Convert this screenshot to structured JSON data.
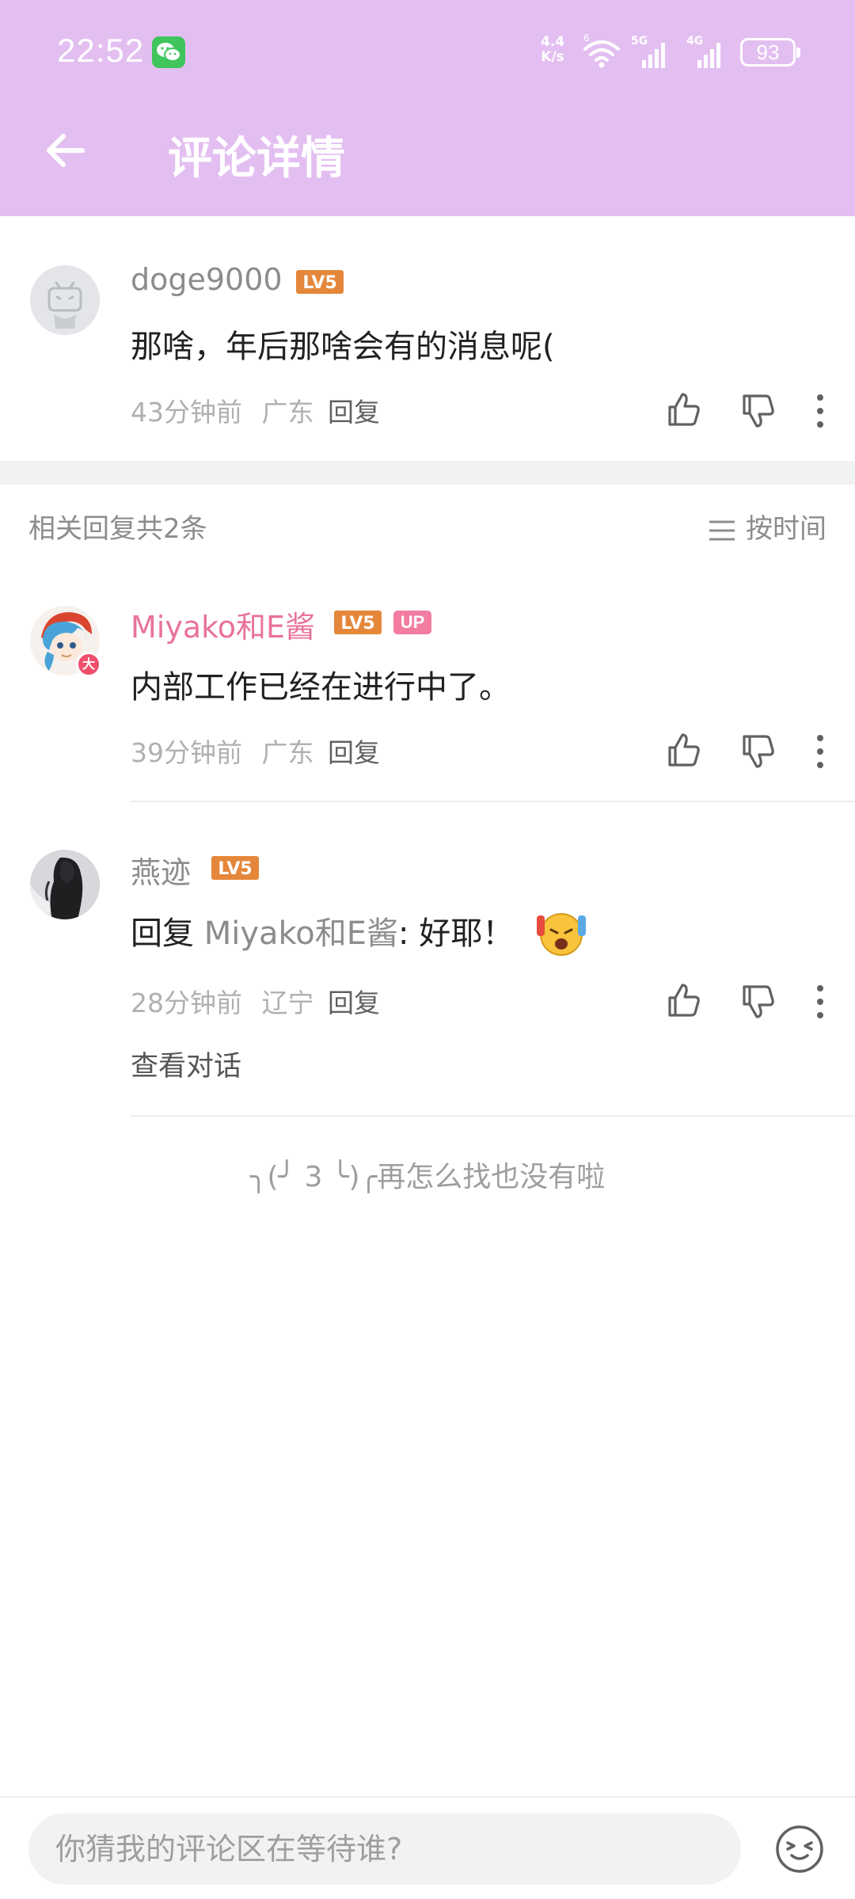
{
  "status_bar": {
    "time": "22:52",
    "net_speed_value": "4.4",
    "net_speed_unit": "K/s",
    "battery": "93"
  },
  "header": {
    "title": "评论详情"
  },
  "root_comment": {
    "username": "doge9000",
    "level": "LV5",
    "text": "那啥，年后那啥会有的消息呢(",
    "time": "43分钟前",
    "location": "广东",
    "reply_label": "回复"
  },
  "replies_header": {
    "count_text": "相关回复共2条",
    "sort_label": "按时间"
  },
  "replies": [
    {
      "username": "Miyako和E酱",
      "level": "LV5",
      "badge": "UP",
      "avatar_badge": "大",
      "text": "内部工作已经在进行中了。",
      "time": "39分钟前",
      "location": "广东",
      "reply_label": "回复"
    },
    {
      "username": "燕迹",
      "level": "LV5",
      "text_prefix": "回复 ",
      "mention": "Miyako和E酱",
      "text_suffix": ": 好耶！",
      "time": "28分钟前",
      "location": "辽宁",
      "reply_label": "回复",
      "view_conversation": "查看对话"
    }
  ],
  "end_message": "╮(╯ 3 ╰)╭再怎么找也没有啦",
  "bottom_bar": {
    "input_placeholder": "你猜我的评论区在等待谁?"
  },
  "colors": {
    "header_bg": "#e3bff1",
    "up_name": "#e8739b",
    "level_badge": "#e4873a",
    "up_badge": "#f27da1"
  }
}
